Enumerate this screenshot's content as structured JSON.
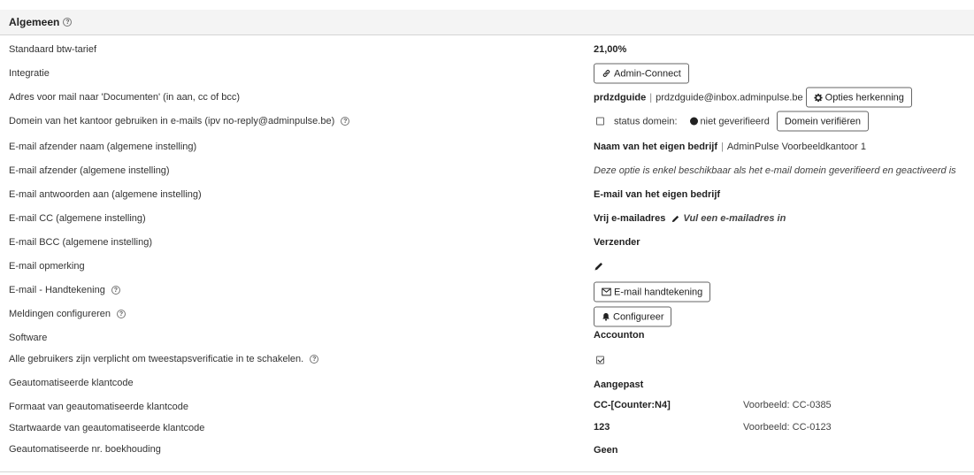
{
  "section": {
    "title": "Algemeen",
    "help_glyph": "?"
  },
  "rows": [
    {
      "label": "Standaard btw-tarief",
      "value": "21,00%"
    },
    {
      "label": "Integratie",
      "button": "Admin-Connect"
    },
    {
      "label": "Adres voor mail naar 'Documenten' (in aan, cc of bcc)",
      "value_bold": "prdzdguide",
      "value": "prdzdguide@inbox.adminpulse.be",
      "button": "Opties herkenning"
    },
    {
      "label": "Domein van het kantoor gebruiken in e-mails (ipv no-reply@adminpulse.be)",
      "status_label": "status domein:",
      "status_value": "niet geverifieerd",
      "button": "Domein verifiëren"
    },
    {
      "label": "E-mail afzender naam (algemene instelling)",
      "value_bold": "Naam van het eigen bedrijf",
      "value": "AdminPulse Voorbeeldkantoor 1"
    },
    {
      "label": "E-mail afzender (algemene instelling)",
      "value_italic": "Deze optie is enkel beschikbaar als het e-mail domein geverifieerd en geactiveerd is"
    },
    {
      "label": "E-mail antwoorden aan (algemene instelling)",
      "value": "E-mail van het eigen bedrijf"
    },
    {
      "label": "E-mail CC (algemene instelling)",
      "value": "Vrij e-mailadres",
      "value_italic": "Vul een e-mailadres in"
    },
    {
      "label": "E-mail BCC (algemene instelling)",
      "value": "Verzender"
    },
    {
      "label": "E-mail opmerking"
    },
    {
      "label": "E-mail - Handtekening",
      "button": "E-mail handtekening"
    },
    {
      "label": "Meldingen configureren",
      "button": "Configureer"
    },
    {
      "label": "Software",
      "value": "Accounton"
    },
    {
      "label": "Alle gebruikers zijn verplicht om tweestapsverificatie in te schakelen."
    },
    {
      "label": "Geautomatiseerde klantcode",
      "value": "Aangepast"
    },
    {
      "label": "Formaat van geautomatiseerde klantcode",
      "value": "CC-[Counter:N4]",
      "example": "Voorbeeld: CC-0385"
    },
    {
      "label": "Startwaarde van geautomatiseerde klantcode",
      "value": "123",
      "example": "Voorbeeld: CC-0123"
    },
    {
      "label": "Geautomatiseerde nr. boekhouding",
      "value": "Geen"
    }
  ],
  "state": {
    "domain_checkbox_checked": false,
    "two_factor_checked": true
  },
  "colors": {
    "header_bg": "#f4f4f4",
    "border": "#d4d4d4",
    "text": "#333333"
  },
  "icons": {
    "integratie_button": "link-icon",
    "opties_button": "gear-icon",
    "cc_edit": "pencil-icon",
    "opmerking_edit": "pencil-icon",
    "handtekening_button": "envelope-icon",
    "configureer_button": "bell-icon",
    "status_dot": "circle-icon"
  }
}
